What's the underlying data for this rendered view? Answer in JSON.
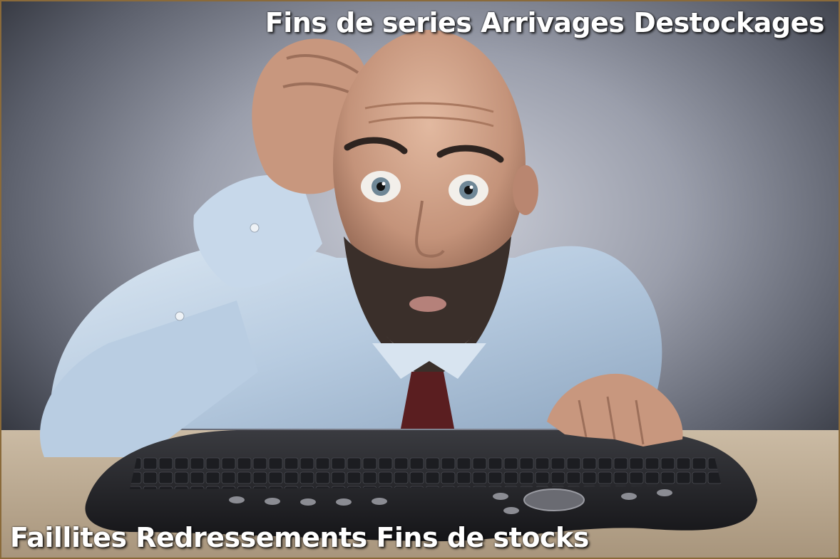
{
  "banner": {
    "top_text": "Fins de series Arrivages Destockages",
    "bottom_text": "Faillites Redressements Fins de stocks"
  },
  "image": {
    "icon": "stock-photo-man-at-keyboard",
    "colors": {
      "background": "#8f93a0",
      "shirt": "#bcd0e4",
      "skin": "#c99a80",
      "beard": "#3a2f2a",
      "tie": "#5a1e20",
      "keyboard": "#26272b",
      "desk": "#bfae98",
      "caption": "#ffffff"
    }
  }
}
